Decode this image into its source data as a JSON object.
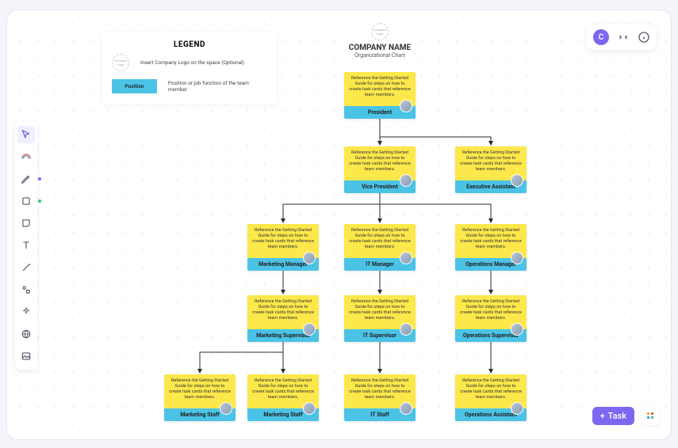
{
  "legend": {
    "title": "LEGEND",
    "logo_text": "Company Logo",
    "logo_desc": "Insert Company Logo on the space (Optional)",
    "position_label": "Position",
    "position_desc": "Position or job function of the team member"
  },
  "company": {
    "logo_text": "Company Logo",
    "name": "COMPANY NAME",
    "subtitle": "Organizational Chart"
  },
  "card_hint": "Reference the Getting Started Guide for steps on how to create task cards that reference team members.",
  "nodes": {
    "president": "President",
    "vp": "Vice President",
    "ea": "Executive Assistant",
    "mkt_mgr": "Marketing Manager",
    "it_mgr": "IT Manager",
    "ops_mgr": "Operations Manager",
    "mkt_sup": "Marketing Supervisor",
    "it_sup": "IT Supervisor",
    "ops_sup": "Operations Supervisor",
    "mkt_staff1": "Marketing Staff",
    "mkt_staff2": "Marketing Staff",
    "it_staff": "IT Staff",
    "ops_asst": "Operations Assistant"
  },
  "toolbar": {
    "tools": [
      "pointer",
      "hand",
      "pen",
      "square",
      "sticky",
      "text",
      "connector",
      "shapes",
      "ai",
      "globe",
      "image"
    ]
  },
  "top_right": {
    "avatar_initial": "C"
  },
  "buttons": {
    "task": "Task"
  },
  "colors": {
    "accent": "#7b68ee",
    "card_body": "#fde84b",
    "card_foot": "#4bc3e6"
  }
}
